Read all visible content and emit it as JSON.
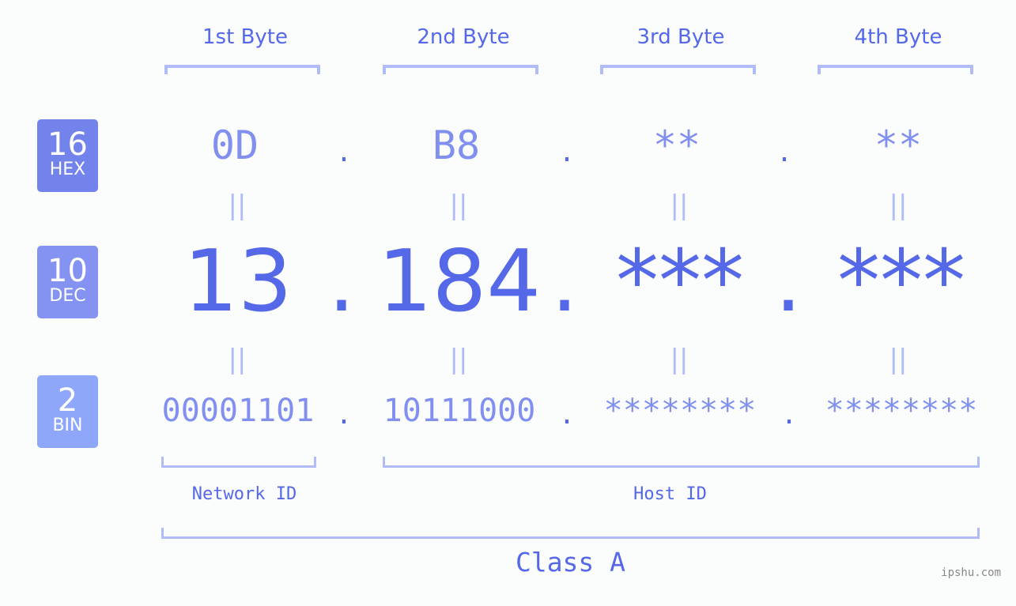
{
  "headers": [
    "1st Byte",
    "2nd Byte",
    "3rd Byte",
    "4th Byte"
  ],
  "badges": [
    {
      "num": "16",
      "label": "HEX",
      "color": "#7383ec"
    },
    {
      "num": "10",
      "label": "DEC",
      "color": "#8493f2"
    },
    {
      "num": "2",
      "label": "BIN",
      "color": "#8fa7fa"
    }
  ],
  "hex": [
    "0D",
    "B8",
    "**",
    "**"
  ],
  "dec": [
    "13",
    "184",
    "***",
    "***"
  ],
  "bin": [
    "00001101",
    "10111000",
    "********",
    "********"
  ],
  "separator": ".",
  "equals_glyph": "||",
  "network_label": "Network ID",
  "host_label": "Host ID",
  "class_label": "Class A",
  "watermark": "ipshu.com",
  "colors": {
    "primary": "#5468e8",
    "secondary": "#8190ef",
    "bracket": "#b1bbf7",
    "background": "#fbfcfc"
  }
}
